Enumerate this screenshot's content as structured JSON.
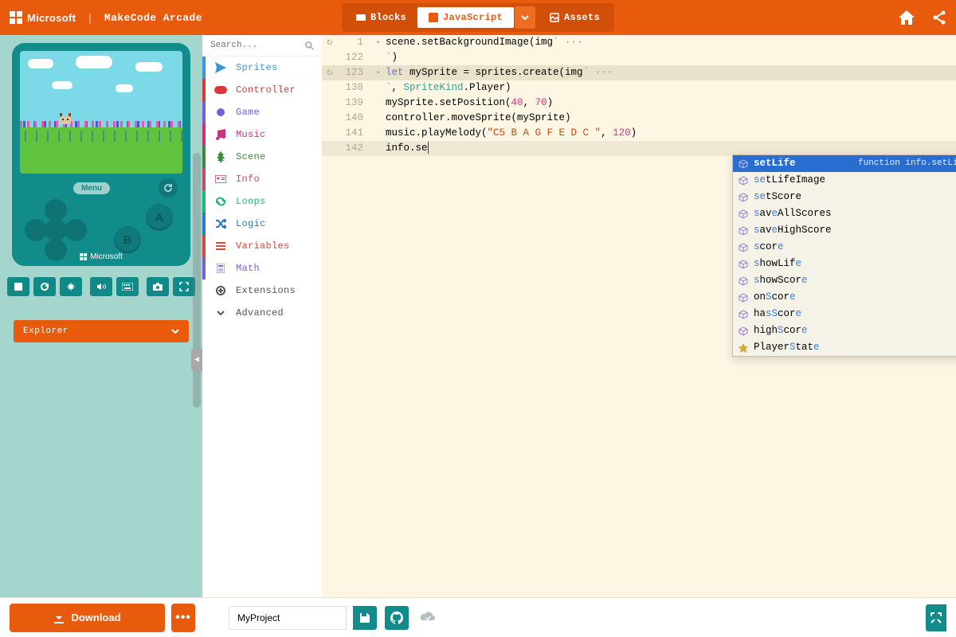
{
  "header": {
    "brand1": "Microsoft",
    "brand2": "MakeCode Arcade",
    "modes": {
      "blocks": "Blocks",
      "javascript": "JavaScript",
      "assets": "Assets"
    }
  },
  "sidebar": {
    "search_placeholder": "Search...",
    "categories": [
      {
        "label": "Sprites",
        "color": "#3898d4",
        "icon": "paper-plane"
      },
      {
        "label": "Controller",
        "color": "#d53a3a",
        "icon": "gamepad"
      },
      {
        "label": "Game",
        "color": "#7b5ed6",
        "icon": "circle"
      },
      {
        "label": "Music",
        "color": "#c9327e",
        "icon": "music"
      },
      {
        "label": "Scene",
        "color": "#3a8a3f",
        "icon": "tree"
      },
      {
        "label": "Info",
        "color": "#c54a6e",
        "icon": "id-card"
      },
      {
        "label": "Loops",
        "color": "#1fb972",
        "icon": "loop"
      },
      {
        "label": "Logic",
        "color": "#2e7cc0",
        "icon": "shuffle"
      },
      {
        "label": "Variables",
        "color": "#d84b3d",
        "icon": "list"
      },
      {
        "label": "Math",
        "color": "#7f5fd0",
        "icon": "calculator"
      },
      {
        "label": "Extensions",
        "color": "#777",
        "icon": "plus-circle"
      },
      {
        "label": "Advanced",
        "color": "#333",
        "icon": "chevron"
      }
    ]
  },
  "simulator": {
    "menu_label": "Menu",
    "brand": "Microsoft",
    "btn_a": "A",
    "btn_b": "B"
  },
  "explorer": {
    "label": "Explorer"
  },
  "editor": {
    "lines": [
      {
        "num": "1",
        "fold": true,
        "recycle": true,
        "html": "scene.setBackgroundImage(img<span class='dim'>` ···</span>"
      },
      {
        "num": "122",
        "fold": false,
        "recycle": false,
        "html": "<span class='dim'>`</span>)"
      },
      {
        "num": "123",
        "fold": true,
        "recycle": true,
        "html": "<span class='kw'>let</span> mySprite = sprites.create(img<span class='dim'>` ···</span>",
        "hl2": true
      },
      {
        "num": "138",
        "fold": false,
        "recycle": false,
        "html": "<span class='dim'>`</span>, <span class='type'>SpriteKind</span>.Player)"
      },
      {
        "num": "139",
        "fold": false,
        "recycle": false,
        "html": "mySprite.setPosition(<span class='num'>40</span>, <span class='num'>70</span>)"
      },
      {
        "num": "140",
        "fold": false,
        "recycle": false,
        "html": "controller.moveSprite(mySprite)"
      },
      {
        "num": "141",
        "fold": false,
        "recycle": false,
        "html": "music.playMelody(<span class='str'>\"C5 B A G F E D C \"</span>, <span class='num'>120</span>)"
      },
      {
        "num": "142",
        "fold": false,
        "recycle": false,
        "html": "info.se<span class='cursor'></span>",
        "hl": true
      }
    ]
  },
  "autocomplete": {
    "selected_detail": "function info.setLife(va…",
    "items": [
      {
        "icon": "cube",
        "pre": "",
        "match": "se",
        "post": "tLife",
        "selected": true,
        "strong": true
      },
      {
        "icon": "cube",
        "pre": "",
        "match": "se",
        "post": "tLifeImage"
      },
      {
        "icon": "cube",
        "pre": "",
        "match": "se",
        "post": "tScore"
      },
      {
        "icon": "cube",
        "pre": "sav",
        "match": "e",
        "post": "AllScores",
        "pre_match": "s"
      },
      {
        "icon": "cube",
        "pre": "sav",
        "match": "e",
        "post": "HighScore",
        "pre_match": "s"
      },
      {
        "icon": "cube",
        "pre": "",
        "match": "s",
        "post": "cor",
        "tail_match": "e"
      },
      {
        "icon": "cube",
        "pre": "",
        "match": "s",
        "post": "howLif",
        "tail_match": "e"
      },
      {
        "icon": "cube",
        "pre": "",
        "match": "s",
        "post": "howScor",
        "tail_match": "e"
      },
      {
        "icon": "cube",
        "pre": "on",
        "match": "S",
        "post": "cor",
        "tail_match": "e"
      },
      {
        "icon": "cube",
        "pre": "ha",
        "match": "sS",
        "post": "cor",
        "tail_match": "e"
      },
      {
        "icon": "cube",
        "pre": "high",
        "match": "S",
        "post": "cor",
        "tail_match": "e"
      },
      {
        "icon": "badge",
        "pre": "Player",
        "match": "S",
        "post": "tat",
        "tail_match": "e"
      }
    ]
  },
  "footer": {
    "download": "Download",
    "project_name": "MyProject"
  }
}
